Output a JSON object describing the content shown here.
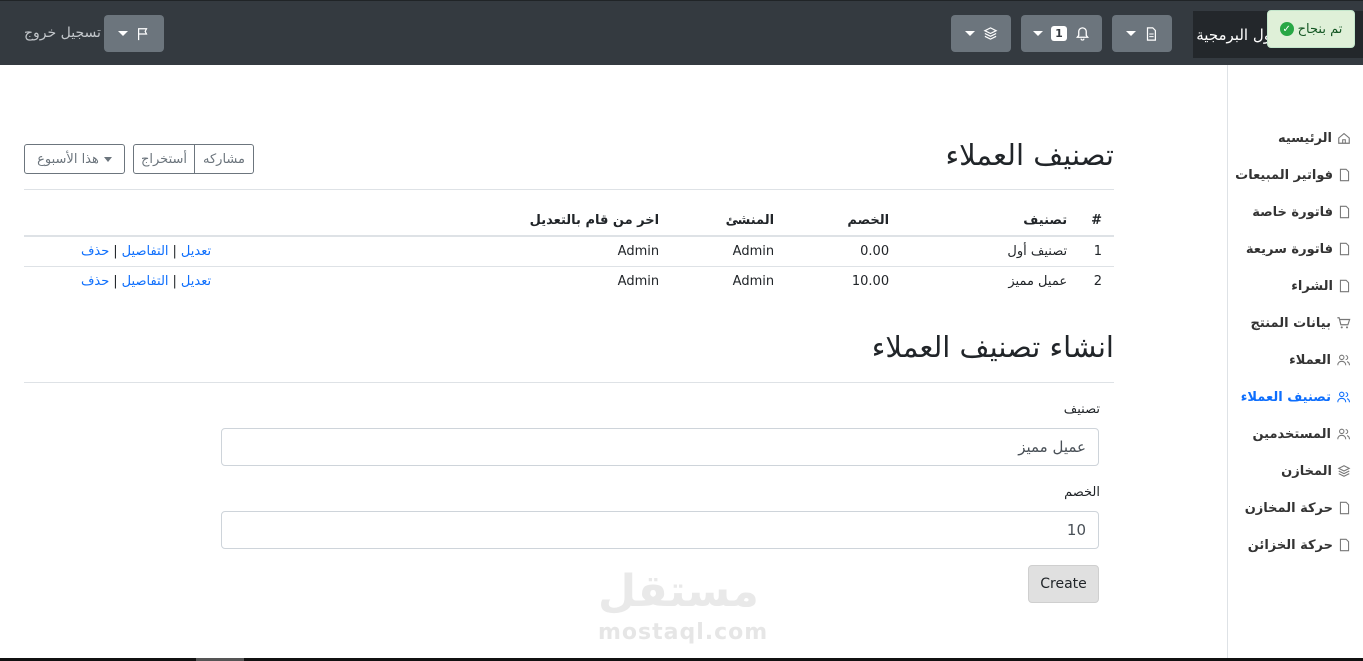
{
  "navbar": {
    "brand": "ول البرمجية",
    "toast": "تم بنجاح",
    "notification_count": "1",
    "logout": "تسجيل خروج",
    "icons": [
      "file-icon",
      "bell-icon",
      "layers-icon",
      "flag-icon"
    ]
  },
  "sidebar": {
    "items": [
      {
        "label": "الرئيسيه",
        "icon": "home-icon"
      },
      {
        "label": "فواتير المبيعات",
        "icon": "file-icon"
      },
      {
        "label": "فاتورة خاصة",
        "icon": "file-icon"
      },
      {
        "label": "فاتورة سريعة",
        "icon": "file-icon"
      },
      {
        "label": "الشراء",
        "icon": "file-icon"
      },
      {
        "label": "بيانات المنتج",
        "icon": "cart-icon"
      },
      {
        "label": "العملاء",
        "icon": "users-icon"
      },
      {
        "label": "تصنيف العملاء",
        "icon": "users-icon"
      },
      {
        "label": "المستخدمين",
        "icon": "users-icon"
      },
      {
        "label": "المخازن",
        "icon": "layers-icon"
      },
      {
        "label": "حركة المخازن",
        "icon": "file-icon"
      },
      {
        "label": "حركة الخزائن",
        "icon": "file-icon"
      }
    ],
    "active_index": 7,
    "active_color": "#0d6efd"
  },
  "main": {
    "title": "تصنيف العملاء",
    "toolbar": {
      "share": "مشاركه",
      "export": "أستخراج",
      "period": "هذا الأسبوع"
    },
    "table": {
      "headers": [
        "#",
        "تصنيف",
        "الخصم",
        "المنشئ",
        "اخر من قام بالتعديل"
      ],
      "rows": [
        {
          "num": "1",
          "name": "تصنيف أول",
          "discount": "0.00",
          "creator": "Admin",
          "modifier": "Admin"
        },
        {
          "num": "2",
          "name": "عميل مميز",
          "discount": "10.00",
          "creator": "Admin",
          "modifier": "Admin"
        }
      ],
      "actions": {
        "edit": "تعديل",
        "details": "التفاصيل",
        "delete": "حذف",
        "separator": "|"
      }
    },
    "form": {
      "title": "انشاء تصنيف العملاء",
      "name_label": "تصنيف",
      "name_value": "عميل مميز",
      "discount_label": "الخصم",
      "discount_value": "10",
      "submit": "Create"
    }
  },
  "watermark": {
    "arabic": "مستقل",
    "latin": "mostaql.com"
  }
}
